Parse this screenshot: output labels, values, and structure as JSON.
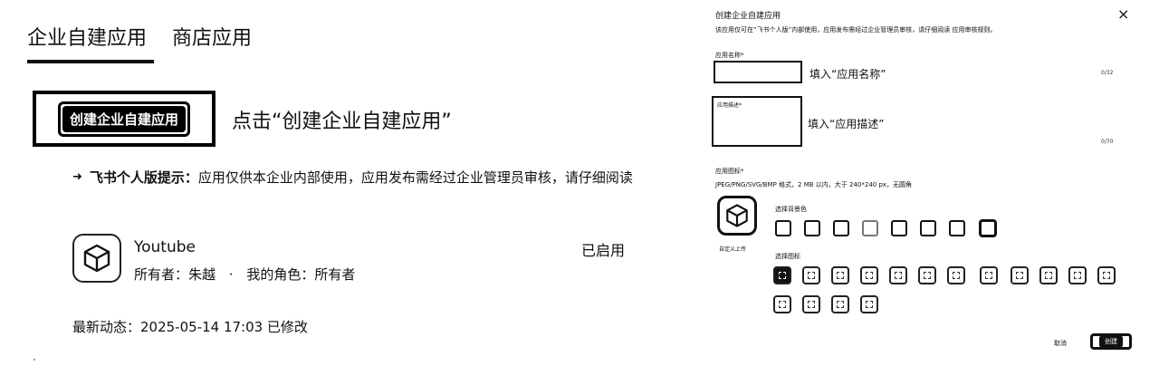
{
  "tabs": [
    {
      "label": "企业自建应用"
    },
    {
      "label": "商店应用"
    }
  ],
  "create": {
    "button_label": "创建企业自建应用",
    "hint": "点击“创建企业自建应用”"
  },
  "notice": {
    "title": "飞书个人版提示：",
    "text": "应用仅供本企业内部使用，应用发布需经过企业管理员审核，请仔细阅读"
  },
  "app": {
    "name": "Youtube",
    "owner": "所有者：朱越",
    "separator": "·",
    "role": "我的角色：所有者",
    "status": "已启用",
    "activity": "最新动态：2025-05-14 17:03 已修改",
    "icon": "cube-icon"
  },
  "dialog": {
    "title": "创建企业自建应用",
    "close": "×",
    "description": "该应用仅可在“飞书个人版”内部使用，应用发布需经过企业管理员审核，请仔细阅读 应用审核规则。",
    "name_label": "应用名称*",
    "name_hint": "填入“应用名称”",
    "name_count": "0/32",
    "desc_label": "应用描述*",
    "desc_hint": "填入“应用描述”",
    "desc_count": "0/70",
    "icon_label": "应用图标*",
    "icon_format": "JPEG/PNG/SVG/BMP 格式，2 MB 以内，大于 240*240 px，无圆角",
    "upload": "自定义上传",
    "bg_label": "选择背景色",
    "icon_choose_label": "选择图标",
    "cancel": "取消",
    "confirm": "创建"
  }
}
